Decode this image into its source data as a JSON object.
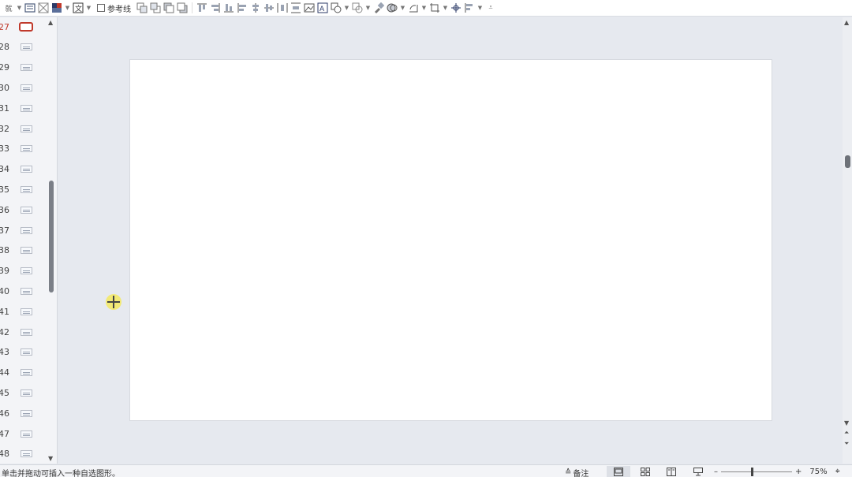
{
  "toolbar": {
    "partial_left_label": "就",
    "guides_checkbox_label": "参考线"
  },
  "thumbnails": [
    {
      "num": "27",
      "active": true
    },
    {
      "num": "28"
    },
    {
      "num": "29"
    },
    {
      "num": "30"
    },
    {
      "num": "31"
    },
    {
      "num": "32"
    },
    {
      "num": "33"
    },
    {
      "num": "34"
    },
    {
      "num": "35"
    },
    {
      "num": "36"
    },
    {
      "num": "37"
    },
    {
      "num": "38"
    },
    {
      "num": "39"
    },
    {
      "num": "40"
    },
    {
      "num": "41"
    },
    {
      "num": "42"
    },
    {
      "num": "43"
    },
    {
      "num": "44"
    },
    {
      "num": "45"
    },
    {
      "num": "46"
    },
    {
      "num": "47"
    },
    {
      "num": "48"
    }
  ],
  "status": {
    "hint": "单击并拖动可插入一种自选图形。",
    "notes_label": "备注",
    "zoom_minus": "–",
    "zoom_plus": "+",
    "zoom_level": "75%"
  },
  "colors": {
    "active_thumb": "#c0392b",
    "cursor_highlight": "#f4e96a"
  }
}
